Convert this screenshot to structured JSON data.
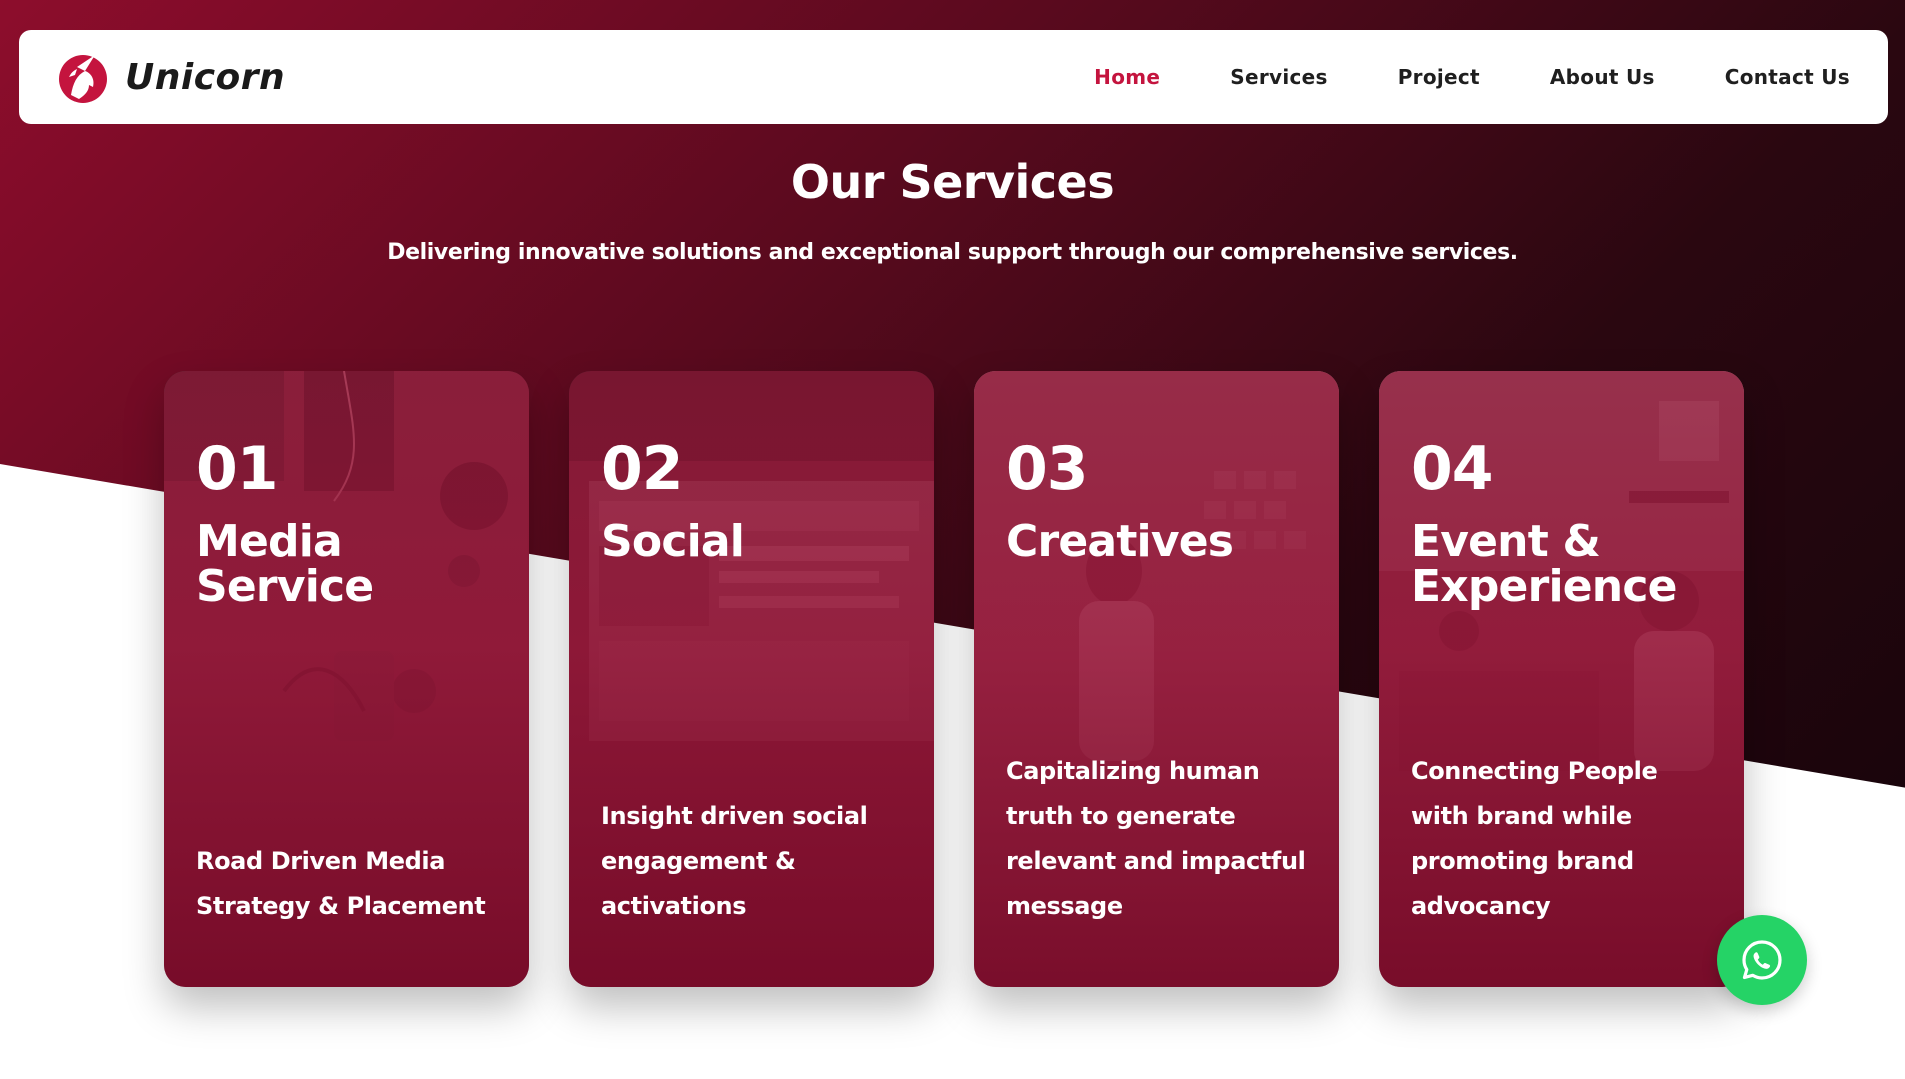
{
  "brand": {
    "name": "Unicorn",
    "logo_icon": "unicorn-logo-icon",
    "accent": "#c4143e"
  },
  "nav": {
    "items": [
      {
        "label": "Home",
        "active": true
      },
      {
        "label": "Services",
        "active": false
      },
      {
        "label": "Project",
        "active": false
      },
      {
        "label": "About Us",
        "active": false
      },
      {
        "label": "Contact Us",
        "active": false
      }
    ]
  },
  "services": {
    "title": "Our Services",
    "subtitle": "Delivering innovative solutions and exceptional support through our comprehensive services.",
    "cards": [
      {
        "number": "01",
        "title": "Media Service",
        "description": "Road Driven Media Strategy & Placement"
      },
      {
        "number": "02",
        "title": "Social",
        "description": "Insight driven social engagement & activations"
      },
      {
        "number": "03",
        "title": "Creatives",
        "description": "Capitalizing human truth to generate relevant and impactful message"
      },
      {
        "number": "04",
        "title": "Event & Experience",
        "description": "Connecting People with brand while promoting brand advocancy"
      }
    ]
  },
  "whatsapp": {
    "icon": "whatsapp-icon",
    "color": "#25d366"
  }
}
